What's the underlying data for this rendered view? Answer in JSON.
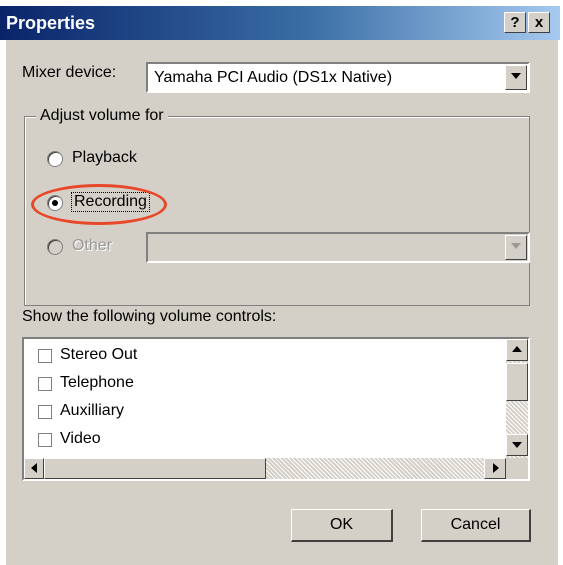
{
  "window": {
    "title": "Properties",
    "help_glyph": "?",
    "close_glyph": "x"
  },
  "mixer": {
    "label": "Mixer device:",
    "value": "Yamaha PCI Audio (DS1x Native)"
  },
  "adjust_group": {
    "legend": "Adjust volume for",
    "options": [
      {
        "label": "Playback",
        "selected": false,
        "enabled": true
      },
      {
        "label": "Recording",
        "selected": true,
        "enabled": true
      },
      {
        "label": "Other",
        "selected": false,
        "enabled": false
      }
    ],
    "other_dropdown_value": ""
  },
  "controls": {
    "label": "Show the following volume controls:",
    "items": [
      {
        "label": "Stereo Out",
        "checked": false
      },
      {
        "label": "Telephone",
        "checked": false
      },
      {
        "label": "Auxilliary",
        "checked": false
      },
      {
        "label": "Video",
        "checked": false
      }
    ]
  },
  "buttons": {
    "ok": "OK",
    "cancel": "Cancel"
  },
  "colors": {
    "titlebar_start": "#0a246a",
    "titlebar_end": "#a6caf0",
    "dialog_face": "#d4d0c8",
    "annotation_circle": "#e8482a"
  }
}
